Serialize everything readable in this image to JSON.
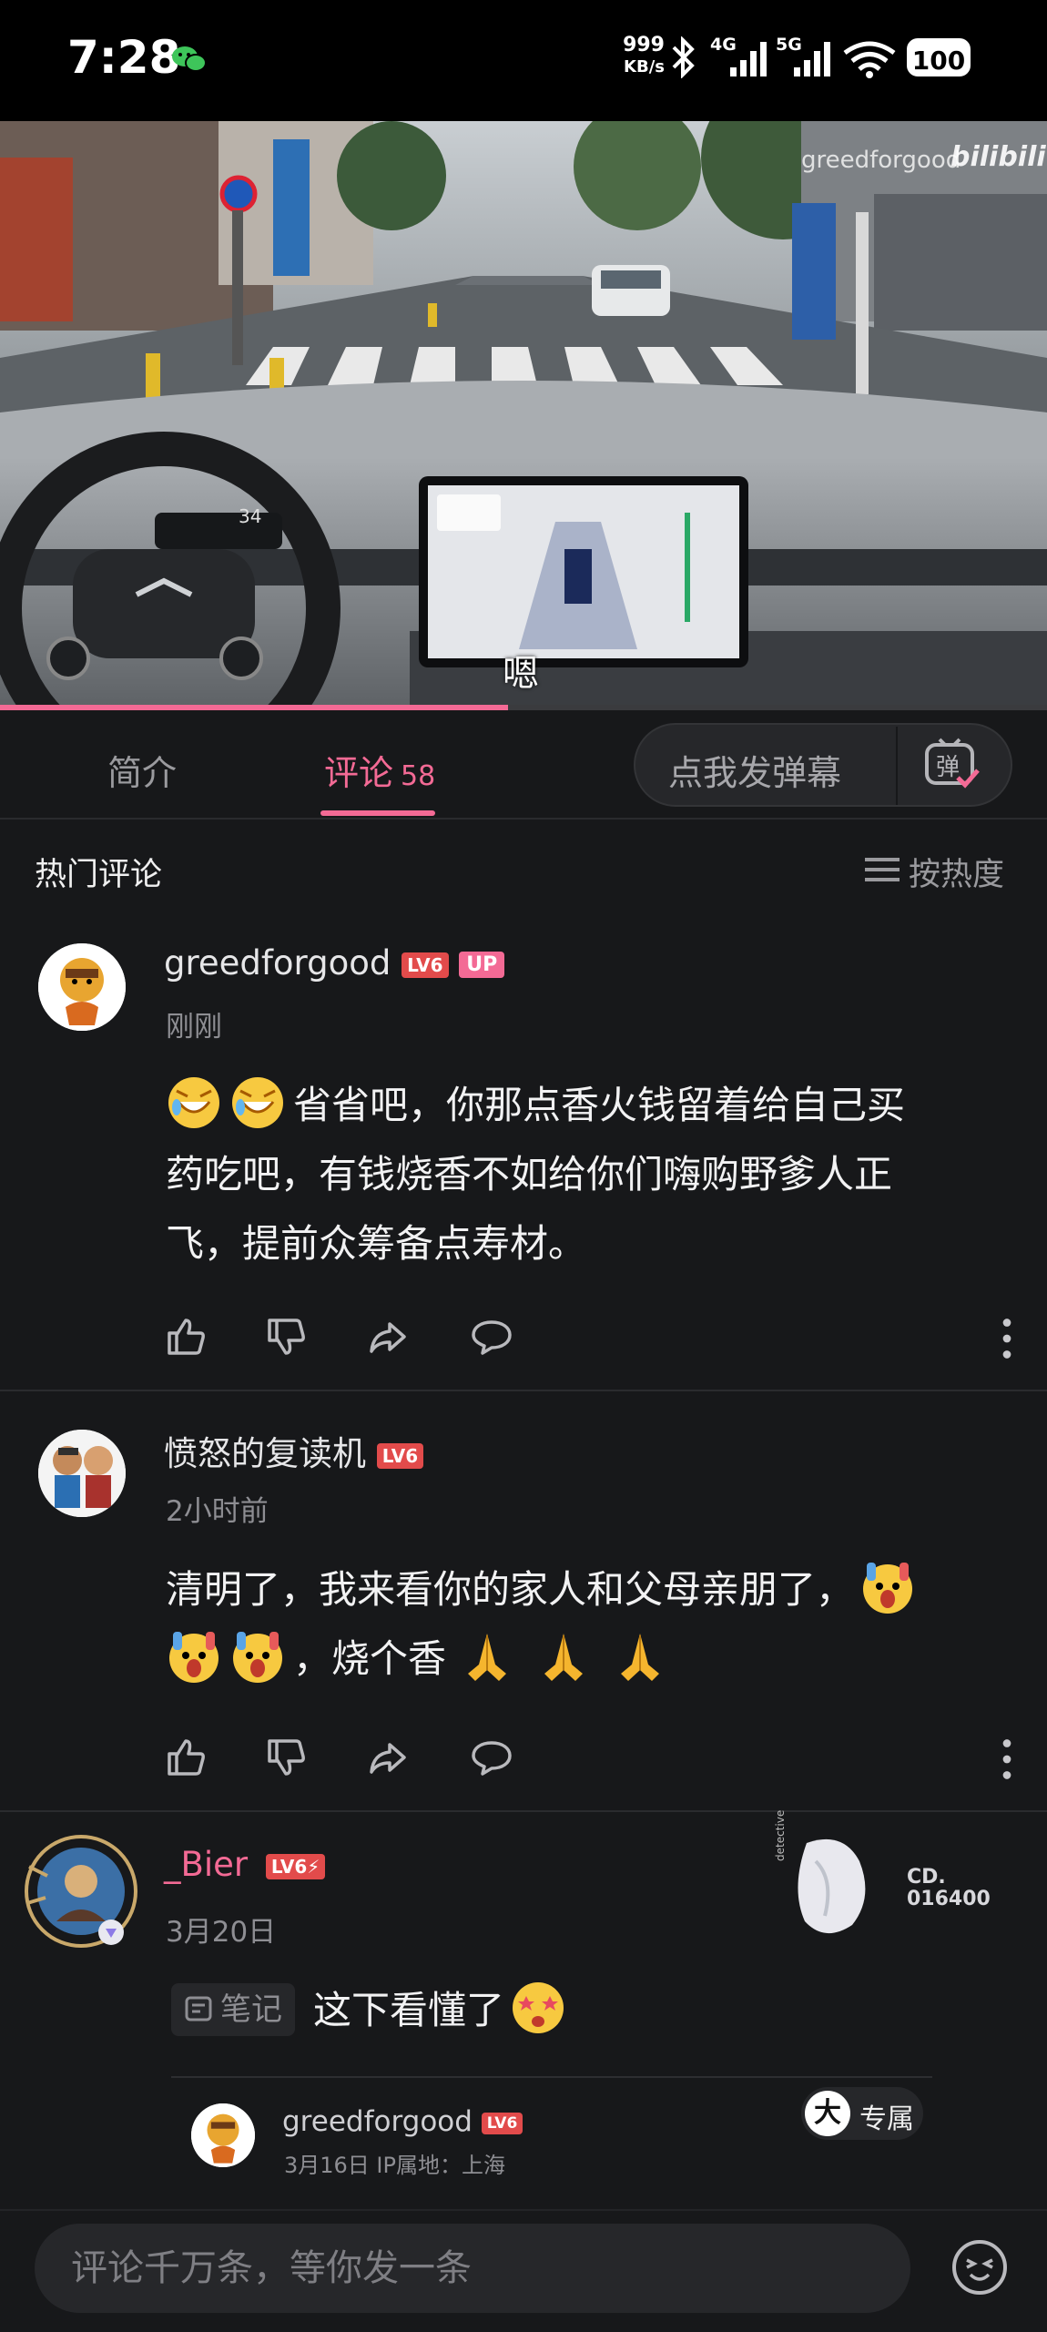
{
  "status_bar": {
    "time": "7:28",
    "net_speed_value": "999",
    "net_speed_unit": "KB/s",
    "signal_1": "4G",
    "signal_2": "5G",
    "battery": "100"
  },
  "video": {
    "watermark": "greedforgood",
    "watermark_brand": "bilibili",
    "subtitle": "嗯",
    "dash_speed": "34",
    "progress_fraction": 0.485
  },
  "tabs": {
    "intro": "简介",
    "comments": "评论",
    "comments_count": "58"
  },
  "danmu": {
    "label": "点我发弹幕",
    "icon_char": "弹"
  },
  "section": {
    "title": "热门评论",
    "sort_label": "按热度"
  },
  "comments": [
    {
      "user": "greedforgood",
      "level": "LV6",
      "badge": "UP",
      "time": "刚刚",
      "line1": "省省吧，你那点香火钱留着给自己买",
      "line2": "药吃吧，有钱烧香不如给你们嗨购野爹人正",
      "line3": "飞，提前众筹备点寿材。"
    },
    {
      "user": "愤怒的复读机",
      "level": "LV6",
      "time": "2小时前",
      "line1": "清明了，我来看你的家人和父母亲朋了，",
      "line2": "，烧个香"
    },
    {
      "user": "_Bier",
      "level": "LV6⚡",
      "time": "3月20日",
      "note_label": "笔记",
      "text": "这下看懂了",
      "deco_code": "CD.",
      "deco_number": "016400",
      "deco_text": "detective",
      "reply": {
        "user": "greedforgood",
        "level": "LV6",
        "meta": "3月16日 IP属地：上海",
        "exclusive_char": "大",
        "exclusive_label": "专属"
      }
    }
  ],
  "bottom": {
    "input_placeholder": "评论千万条，等你发一条"
  },
  "colors": {
    "accent": "#f36a95",
    "background": "#17181a",
    "level_badge": "#e24b4b"
  }
}
